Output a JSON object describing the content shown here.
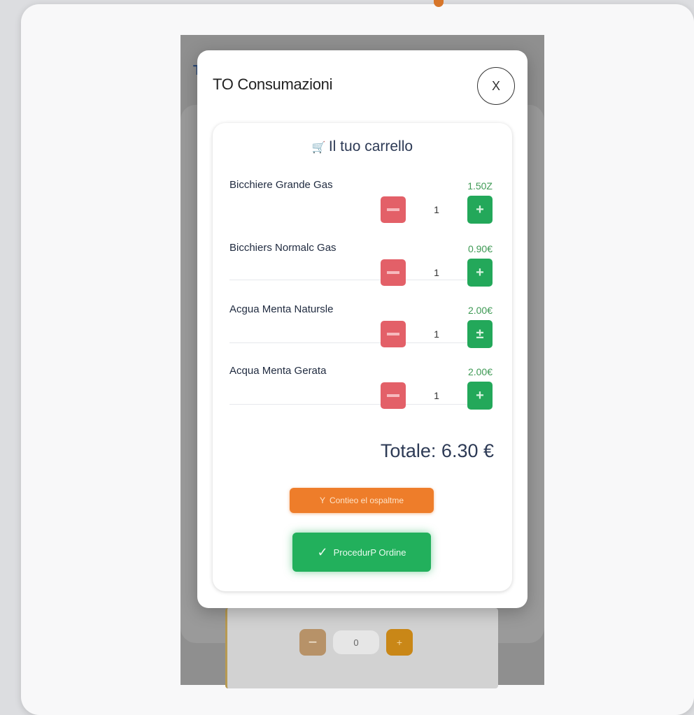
{
  "background": {
    "edge_text": "T",
    "bottom_qty": "0",
    "bottom_minus": "−",
    "bottom_plus": "+"
  },
  "modal": {
    "title": "TO Consumazioni",
    "close_label": "X"
  },
  "cart": {
    "title": "Il tuo carrello",
    "cart_icon": "🛒",
    "items": [
      {
        "name": "Bicchiere Grande Gas",
        "price": "1.50Z",
        "qty": "1",
        "plus": "+"
      },
      {
        "name": "Bicchiers Normalc Gas",
        "price": "0.90€",
        "qty": "1",
        "plus": "+"
      },
      {
        "name": "Acgua Menta Natursle",
        "price": "2.00€",
        "qty": "1",
        "plus": "±"
      },
      {
        "name": "Acqua Menta Gerata",
        "price": "2.00€",
        "qty": "1",
        "plus": "+"
      }
    ],
    "total": "Totale: 6.30 €",
    "continue_label": "Contieo el ospaltme",
    "continue_icon": "Y",
    "proceed_label": "ProcedurP Ordine",
    "proceed_icon": "✓"
  },
  "colors": {
    "minus": "#e36068",
    "plus": "#23a85a",
    "continue": "#ee7d2a",
    "proceed": "#22b05c"
  }
}
